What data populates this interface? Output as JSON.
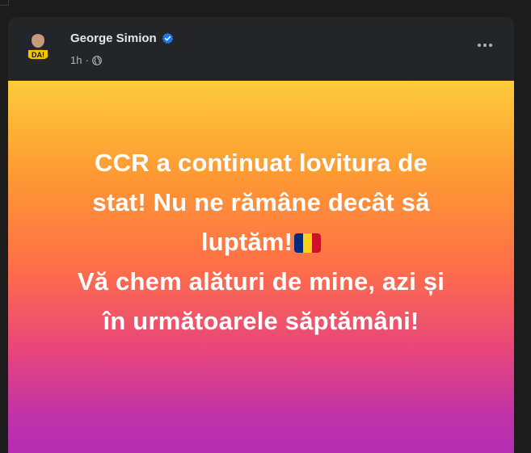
{
  "post": {
    "author": "George Simion",
    "time": "1h",
    "dot": "·",
    "avatar_text": "DA!",
    "text_line1": "CCR a continuat lovitura de",
    "text_line2": "stat! Nu ne rămâne decât să",
    "text_line3": "luptăm!",
    "text_line4": "Vă chem alături de mine, azi și",
    "text_line5": "în următoarele săptămâni!",
    "flag_colors": [
      "#002b7f",
      "#fcd116",
      "#ce1126"
    ],
    "gradient_colors": [
      "#fdcb3a",
      "#ff6f48",
      "#b42db3"
    ],
    "verified_color": "#1877f2"
  }
}
